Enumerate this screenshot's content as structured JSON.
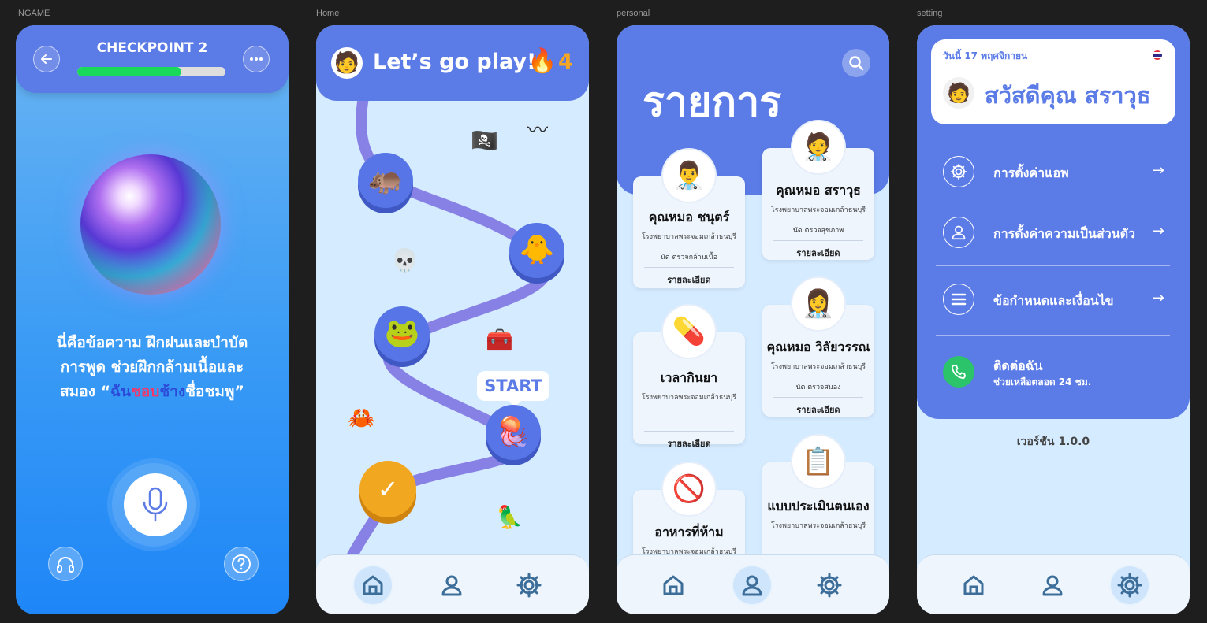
{
  "labels": {
    "ingame": "INGAME",
    "home": "Home",
    "personal": "personal",
    "setting": "setting"
  },
  "ingame": {
    "title": "CHECKPOINT 2",
    "progress": 0.7,
    "msg_line1": "นี่คือข้อความ ฝึกฝนและบำบัด",
    "msg_line2": "การพูด ช่วยฝึกกล้ามเนื้อและ",
    "msg_line3_pre": "สมอง “",
    "msg_w1": "ฉัน",
    "msg_w2": "ชอบ",
    "msg_w3": "ช้าง",
    "msg_w4": "ชื่อชมพู”",
    "icons": {
      "back": "back-arrow-icon",
      "more": "more-dots-icon",
      "mic": "microphone-icon",
      "headphones": "headphones-icon",
      "help": "help-icon"
    }
  },
  "home": {
    "greeting": "Let’s go play!",
    "streak": "4",
    "start": "START",
    "nodes": [
      {
        "name": "hippo",
        "emoji": "🦛"
      },
      {
        "name": "chick",
        "emoji": "🐥"
      },
      {
        "name": "frog",
        "emoji": "🐸"
      },
      {
        "name": "jellyfish",
        "emoji": "🪼"
      },
      {
        "name": "done",
        "emoji": "✓"
      }
    ]
  },
  "personal": {
    "title": "รายการ",
    "cards": [
      {
        "name": "คุณหมอ ชนุตร์",
        "hospital": "โรงพยาบาลพระจอมเกล้าธนบุรี",
        "sub": "นัด ตรวจกล้ามเนื้อ",
        "detail": "รายละเอียด",
        "icon": "👨‍⚕️"
      },
      {
        "name": "คุณหมอ สราวุธ",
        "hospital": "โรงพยาบาลพระจอมเกล้าธนบุรี",
        "sub": "นัด ตรวจสุขภาพ",
        "detail": "รายละเอียด",
        "icon": "🧑‍⚕️"
      },
      {
        "name": "เวลากินยา",
        "hospital": "โรงพยาบาลพระจอมเกล้าธนบุรี",
        "sub": "",
        "detail": "รายละเอียด",
        "icon": "💊"
      },
      {
        "name": "คุณหมอ วิลัยวรรณ",
        "hospital": "โรงพยาบาลพระจอมเกล้าธนบุรี",
        "sub": "นัด ตรวจสมอง",
        "detail": "รายละเอียด",
        "icon": "👩‍⚕️"
      },
      {
        "name": "อาหารที่ห้าม",
        "hospital": "โรงพยาบาลพระจอมเกล้าธนบุรี",
        "sub": "",
        "detail": "",
        "icon": "🚫"
      },
      {
        "name": "แบบประเมินตนเอง",
        "hospital": "โรงพยาบาลพระจอมเกล้าธนบุรี",
        "sub": "",
        "detail": "",
        "icon": "📋"
      }
    ]
  },
  "setting": {
    "date": "วันนี้ 17 พฤศจิกายน",
    "greeting": "สวัสดีคุณ สราวุธ",
    "items": [
      {
        "label": "การตั้งค่าแอพ",
        "icon": "gear-icon"
      },
      {
        "label": "การตั้งค่าความเป็นส่วนตัว",
        "icon": "user-icon"
      },
      {
        "label": "ข้อกำหนดและเงื่อนไข",
        "icon": "menu-icon"
      }
    ],
    "contact_title": "ติดต่อฉัน",
    "contact_sub": "ช่วยเหลือตลอด 24 ชม.",
    "version": "เวอร์ชัน 1.0.0"
  },
  "colors": {
    "primary": "#5b7be6",
    "accent_green": "#19d95a",
    "bg_light": "#d5ebff",
    "streak": "#f5a623"
  }
}
